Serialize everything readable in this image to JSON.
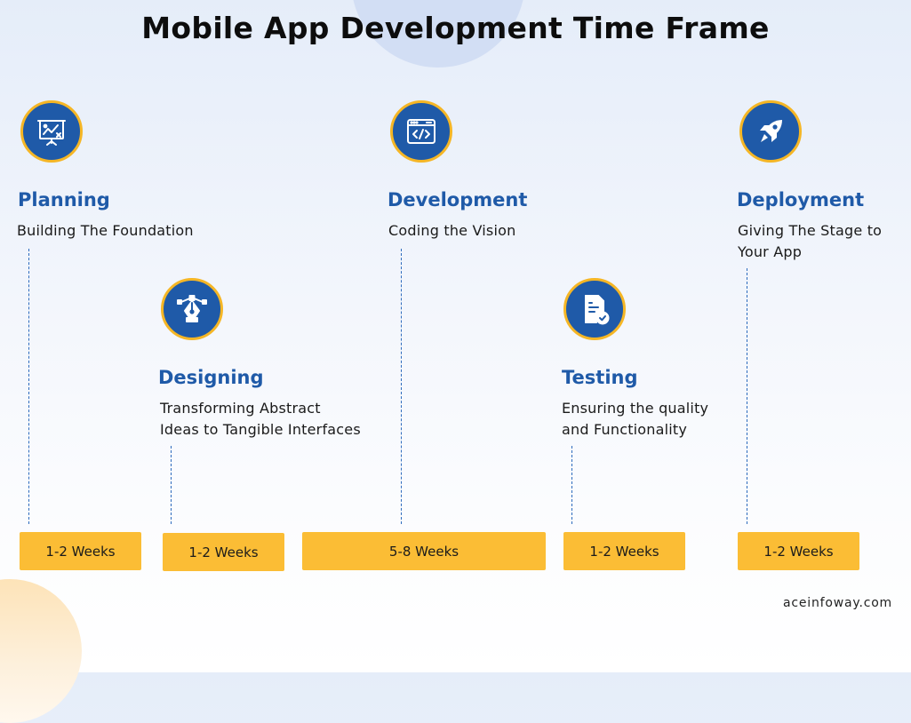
{
  "title": "Mobile App Development Time Frame",
  "stages": [
    {
      "id": "planning",
      "icon": "presentation-board-icon",
      "title": "Planning",
      "description": "Building The Foundation",
      "duration": "1-2 Weeks"
    },
    {
      "id": "designing",
      "icon": "pen-tool-icon",
      "title": "Designing",
      "description": "Transforming Abstract\nIdeas to Tangible Interfaces",
      "duration": "1-2 Weeks"
    },
    {
      "id": "development",
      "icon": "code-window-icon",
      "title": "Development",
      "description": "Coding the Vision",
      "duration": "5-8 Weeks"
    },
    {
      "id": "testing",
      "icon": "checked-document-icon",
      "title": "Testing",
      "description": "Ensuring the quality\nand Functionality",
      "duration": "1-2 Weeks"
    },
    {
      "id": "deployment",
      "icon": "rocket-icon",
      "title": "Deployment",
      "description": "Giving The Stage to\nYour App",
      "duration": "1-2 Weeks"
    }
  ],
  "colors": {
    "primary": "#1f5aa8",
    "accent": "#f5b625",
    "pill": "#fbbd35"
  },
  "footer": {
    "website": "aceinfoway.com"
  }
}
